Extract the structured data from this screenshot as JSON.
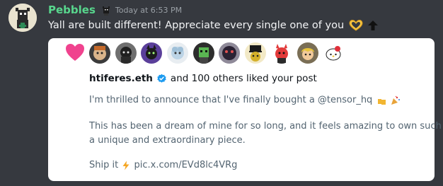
{
  "message": {
    "username": "Pebbles",
    "timestamp": "Today at 6:53 PM",
    "text": "Yall are built different! Appreciate every single one of you",
    "emojis": [
      "heart-hands-icon",
      "up-arrow-icon"
    ]
  },
  "card": {
    "heart_color": "#f0428e",
    "liker_avatars": [
      {
        "name": "avatar-1",
        "bg": "#2e2e2e"
      },
      {
        "name": "avatar-2",
        "bg": "#3a3a3a"
      },
      {
        "name": "avatar-3",
        "bg": "#6a4aa8"
      },
      {
        "name": "avatar-4",
        "bg": "#dbe4ea"
      },
      {
        "name": "avatar-5",
        "bg": "#2a2a2a"
      },
      {
        "name": "avatar-6",
        "bg": "#3b2f4a"
      },
      {
        "name": "avatar-7",
        "bg": "#b8a33a"
      },
      {
        "name": "avatar-8",
        "bg": "#2c2c2c"
      },
      {
        "name": "avatar-9",
        "bg": "#6b6248"
      },
      {
        "name": "avatar-10",
        "bg": "#ffffff"
      }
    ],
    "liker_name": "htiferes.eth",
    "liker_rest": "and 100 others liked your post",
    "post_line1": "I'm thrilled to announce that I've finally bought a @tensor_hq",
    "post_line2": "This has been a dream of mine for so long, and it feels amazing to own such",
    "post_line3": "a unique and extraordinary piece.",
    "post_line4_prefix": "Ship it",
    "post_line4_link": "pic.x.com/EVd8lc4VRg"
  },
  "colors": {
    "background": "#36393f",
    "username": "#58d68d",
    "verified": "#1d9bf0"
  }
}
